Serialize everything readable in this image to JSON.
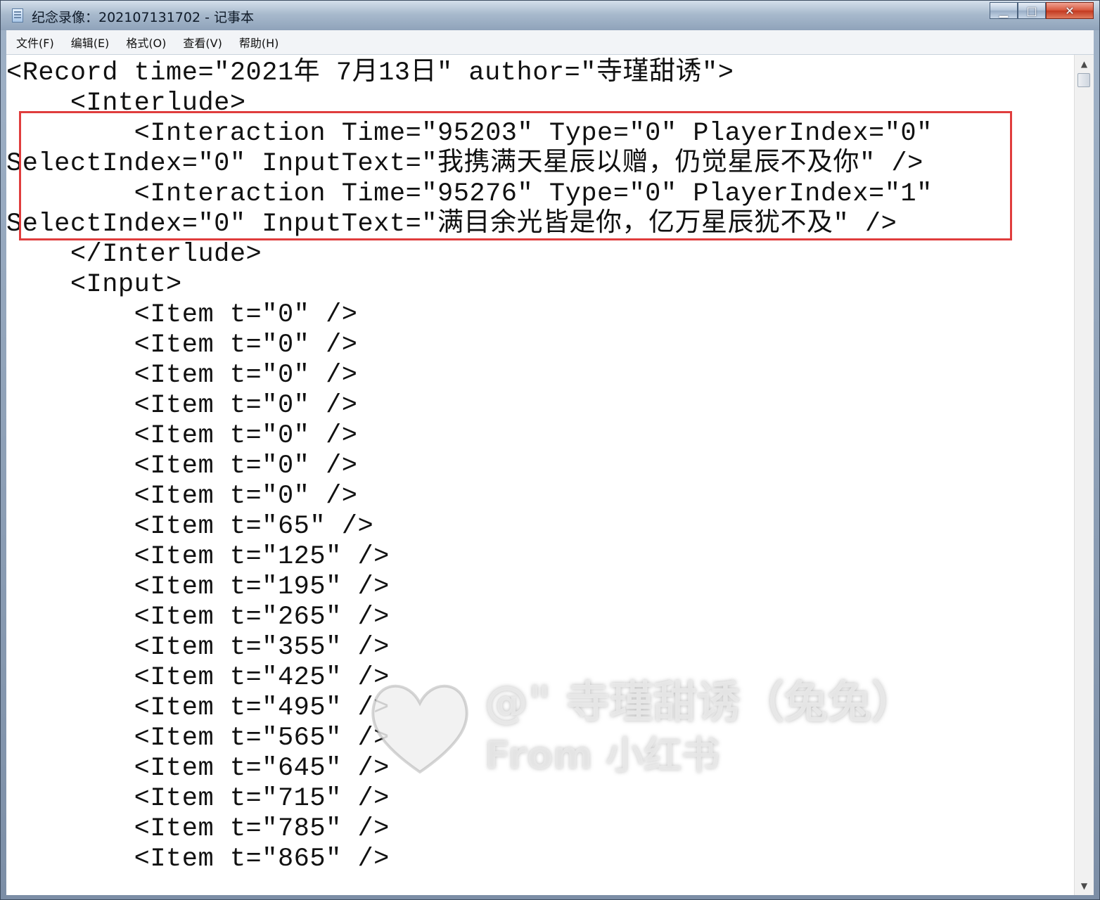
{
  "window": {
    "title": "纪念录像：202107131702 - 记事本",
    "minimize_symbol": "▁",
    "maximize_symbol": "□",
    "close_symbol": "✕"
  },
  "menu": [
    "文件(F)",
    "编辑(E)",
    "格式(O)",
    "查看(V)",
    "帮助(H)"
  ],
  "document": {
    "lines": [
      "<Record time=\"2021年 7月13日\" author=\"寺瑾甜诱\">",
      "    <Interlude>",
      "        <Interaction Time=\"95203\" Type=\"0\" PlayerIndex=\"0\"",
      "SelectIndex=\"0\" InputText=\"我携满天星辰以赠，仍觉星辰不及你\" />",
      "        <Interaction Time=\"95276\" Type=\"0\" PlayerIndex=\"1\"",
      "SelectIndex=\"0\" InputText=\"满目余光皆是你，亿万星辰犹不及\" />",
      "    </Interlude>",
      "    <Input>",
      "        <Item t=\"0\" />",
      "        <Item t=\"0\" />",
      "        <Item t=\"0\" />",
      "        <Item t=\"0\" />",
      "        <Item t=\"0\" />",
      "        <Item t=\"0\" />",
      "        <Item t=\"0\" />",
      "        <Item t=\"65\" />",
      "        <Item t=\"125\" />",
      "        <Item t=\"195\" />",
      "        <Item t=\"265\" />",
      "        <Item t=\"355\" />",
      "        <Item t=\"425\" />",
      "        <Item t=\"495\" />",
      "        <Item t=\"565\" />",
      "        <Item t=\"645\" />",
      "        <Item t=\"715\" />",
      "        <Item t=\"785\" />",
      "        <Item t=\"865\" />"
    ]
  },
  "watermark": {
    "line1": "@\" 寺瑾甜诱（兔兔）",
    "line2": "From 小红书"
  },
  "scrollbar": {
    "up_symbol": "▲",
    "down_symbol": "▼"
  },
  "colors": {
    "highlight_box": "#e03d3d",
    "editor_background": "#ffffff",
    "close_button": "#c33a20"
  }
}
